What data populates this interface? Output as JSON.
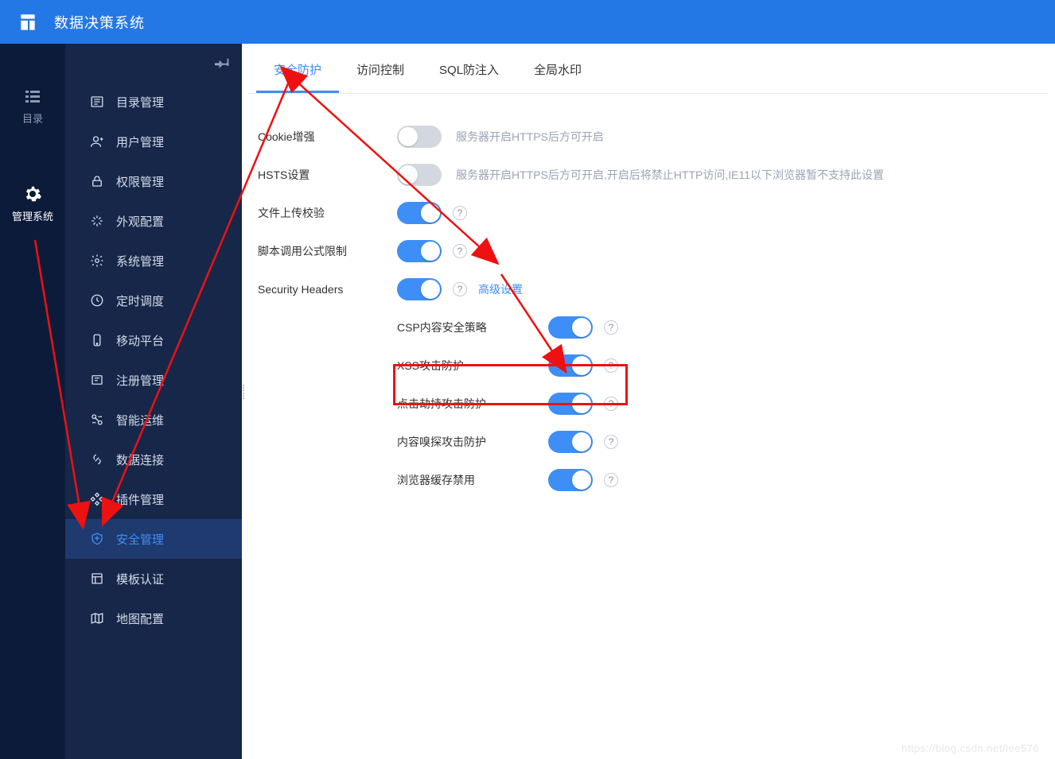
{
  "topbar": {
    "title": "数据决策系统"
  },
  "rail": {
    "items": [
      {
        "label": "目录",
        "icon": "list-icon",
        "active": false
      },
      {
        "label": "管理系统",
        "icon": "gear-icon",
        "active": true
      }
    ]
  },
  "sidebar": {
    "items": [
      {
        "label": "目录管理",
        "icon": "folder-icon"
      },
      {
        "label": "用户管理",
        "icon": "user-icon"
      },
      {
        "label": "权限管理",
        "icon": "lock-icon"
      },
      {
        "label": "外观配置",
        "icon": "palette-icon"
      },
      {
        "label": "系统管理",
        "icon": "settings-icon"
      },
      {
        "label": "定时调度",
        "icon": "clock-icon"
      },
      {
        "label": "移动平台",
        "icon": "mobile-icon"
      },
      {
        "label": "注册管理",
        "icon": "register-icon"
      },
      {
        "label": "智能运维",
        "icon": "ops-icon"
      },
      {
        "label": "数据连接",
        "icon": "link-icon"
      },
      {
        "label": "插件管理",
        "icon": "plugin-icon"
      },
      {
        "label": "安全管理",
        "icon": "shield-icon",
        "active": true
      },
      {
        "label": "模板认证",
        "icon": "template-icon"
      },
      {
        "label": "地图配置",
        "icon": "map-icon"
      }
    ]
  },
  "tabs": [
    {
      "label": "安全防护",
      "active": true
    },
    {
      "label": "访问控制"
    },
    {
      "label": "SQL防注入"
    },
    {
      "label": "全局水印"
    }
  ],
  "settings": {
    "cookie": {
      "label": "Cookie增强",
      "on": false,
      "desc": "服务器开启HTTPS后方可开启"
    },
    "hsts": {
      "label": "HSTS设置",
      "on": false,
      "desc": "服务器开启HTTPS后方可开启,开启后将禁止HTTP访问,IE11以下浏览器暂不支持此设置"
    },
    "upload": {
      "label": "文件上传校验",
      "on": true
    },
    "script": {
      "label": "脚本调用公式限制",
      "on": true
    },
    "security_headers": {
      "label": "Security Headers",
      "on": true,
      "advanced_link": "高级设置",
      "subitems": [
        {
          "label": "CSP内容安全策略",
          "on": true
        },
        {
          "label": "XSS攻击防护",
          "on": true
        },
        {
          "label": "点击劫持攻击防护",
          "on": true,
          "highlighted": true
        },
        {
          "label": "内容嗅探攻击防护",
          "on": true
        },
        {
          "label": "浏览器缓存禁用",
          "on": true
        }
      ]
    }
  },
  "watermark": "https://blog.csdn.net/lee576"
}
